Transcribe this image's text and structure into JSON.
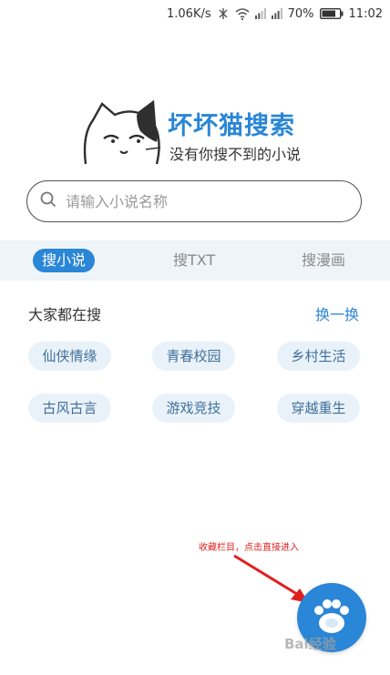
{
  "status_bar": {
    "speed": "1.06K/s",
    "battery": "70%",
    "time": "11:02",
    "icons": [
      "bluetooth-off-icon",
      "wifi-icon",
      "signal-icon",
      "signal-icon",
      "battery-icon"
    ]
  },
  "logo": {
    "title": "坏坏猫搜索",
    "slogan": "没有你搜不到的小说"
  },
  "search": {
    "placeholder": "请输入小说名称",
    "value": ""
  },
  "tabs": [
    {
      "label": "搜小说",
      "active": true
    },
    {
      "label": "搜TXT",
      "active": false
    },
    {
      "label": "搜漫画",
      "active": false
    }
  ],
  "hot": {
    "title": "大家都在搜",
    "refresh_label": "换一换",
    "tags": [
      "仙侠情缘",
      "青春校园",
      "乡村生活",
      "古风古言",
      "游戏竞技",
      "穿越重生"
    ]
  },
  "annotation": {
    "text": "收藏栏目，点击直接进入"
  },
  "fab": {
    "icon": "cat-paw-icon"
  },
  "watermark": "Bai经验",
  "colors": {
    "accent": "#2a86d6",
    "tab_bar_bg": "#eef4f8",
    "tag_bg": "#eaf2f9",
    "annotation": "#e0201f"
  }
}
